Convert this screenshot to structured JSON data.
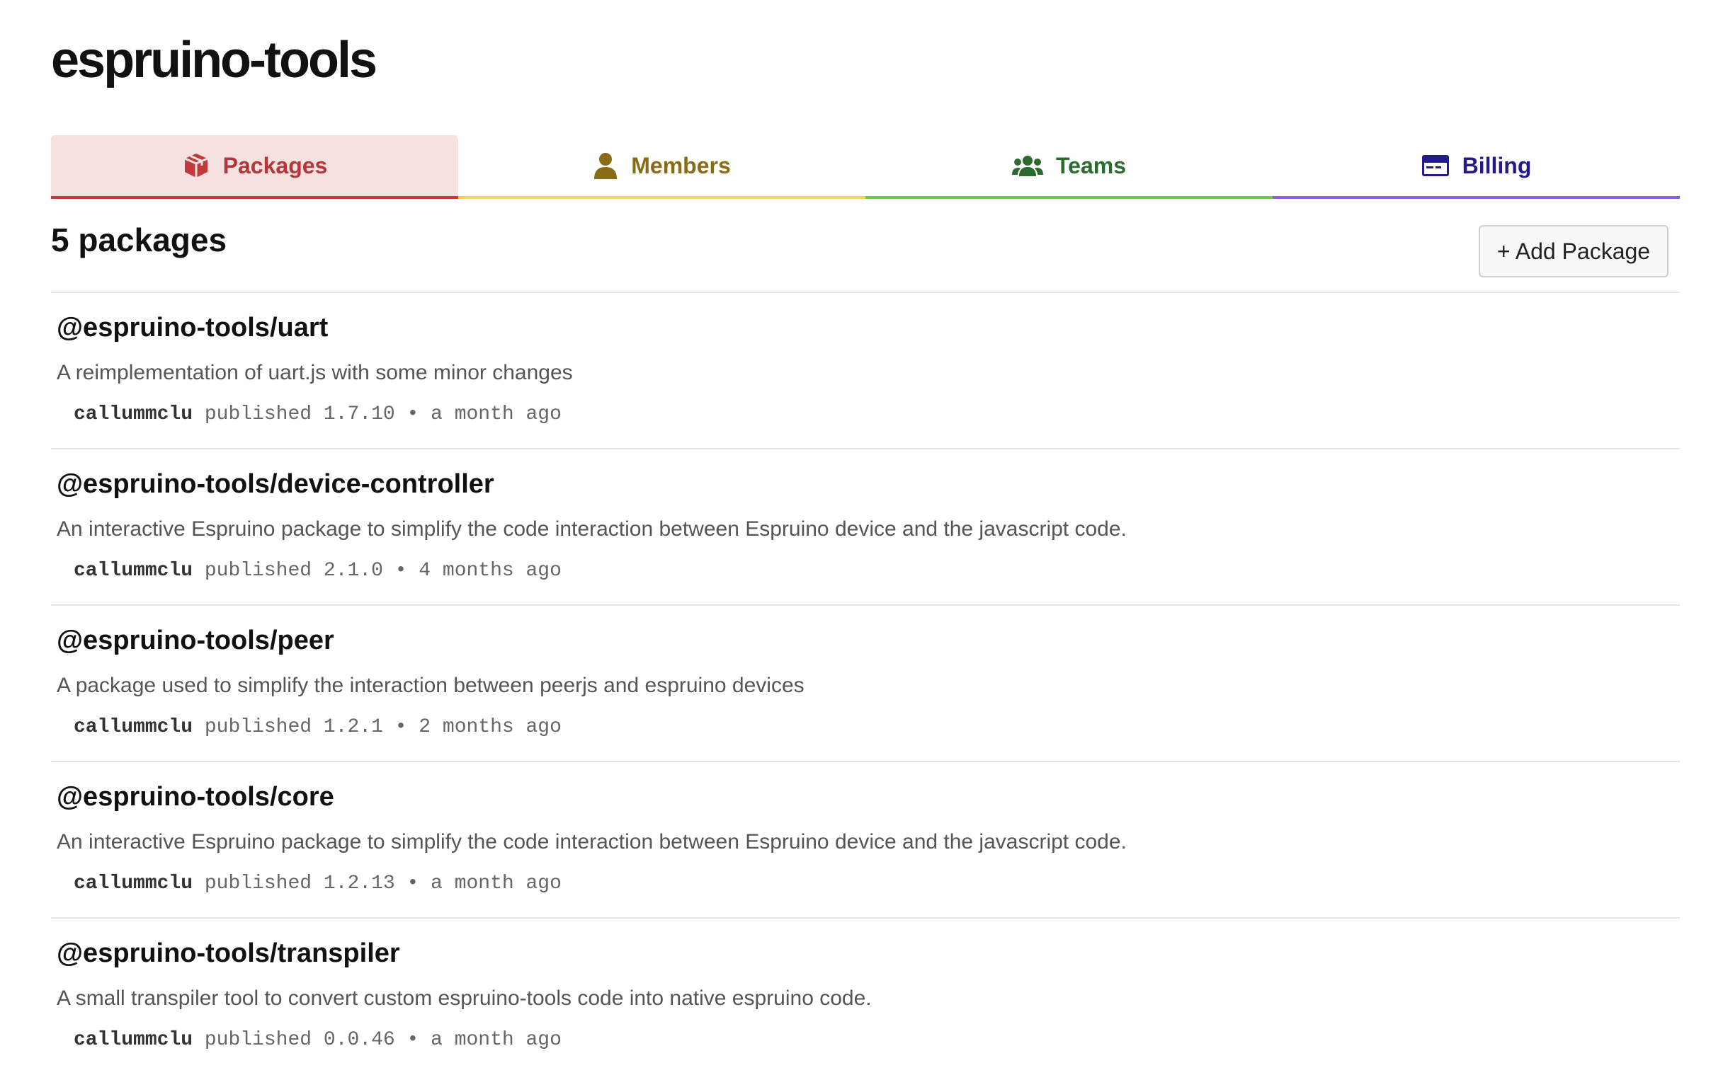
{
  "org": {
    "name": "espruino-tools"
  },
  "tabs": [
    {
      "label": "Packages",
      "icon": "package-icon",
      "color": "#b3373a",
      "active": true
    },
    {
      "label": "Members",
      "icon": "user-icon",
      "color": "#876b15",
      "active": false
    },
    {
      "label": "Teams",
      "icon": "users-icon",
      "color": "#2c6b2f",
      "active": false
    },
    {
      "label": "Billing",
      "icon": "credit-card-icon",
      "color": "#231b8a",
      "active": false
    }
  ],
  "packages_header": {
    "count_label": "5 packages",
    "add_button": "+ Add Package"
  },
  "packages": [
    {
      "name": "@espruino-tools/uart",
      "description": "A reimplementation of uart.js with some minor changes",
      "author": "callummclu",
      "published": " published 1.7.10 • a month ago"
    },
    {
      "name": "@espruino-tools/device-controller",
      "description": "An interactive Espruino package to simplify the code interaction between Espruino device and the javascript code.",
      "author": "callummclu",
      "published": " published 2.1.0 • 4 months ago"
    },
    {
      "name": "@espruino-tools/peer",
      "description": "A package used to simplify the interaction between peerjs and espruino devices",
      "author": "callummclu",
      "published": " published 1.2.1 • 2 months ago"
    },
    {
      "name": "@espruino-tools/core",
      "description": "An interactive Espruino package to simplify the code interaction between Espruino device and the javascript code.",
      "author": "callummclu",
      "published": " published 1.2.13 • a month ago"
    },
    {
      "name": "@espruino-tools/transpiler",
      "description": "A small transpiler tool to convert custom espruino-tools code into native espruino code.",
      "author": "callummclu",
      "published": " published 0.0.46 • a month ago"
    }
  ]
}
